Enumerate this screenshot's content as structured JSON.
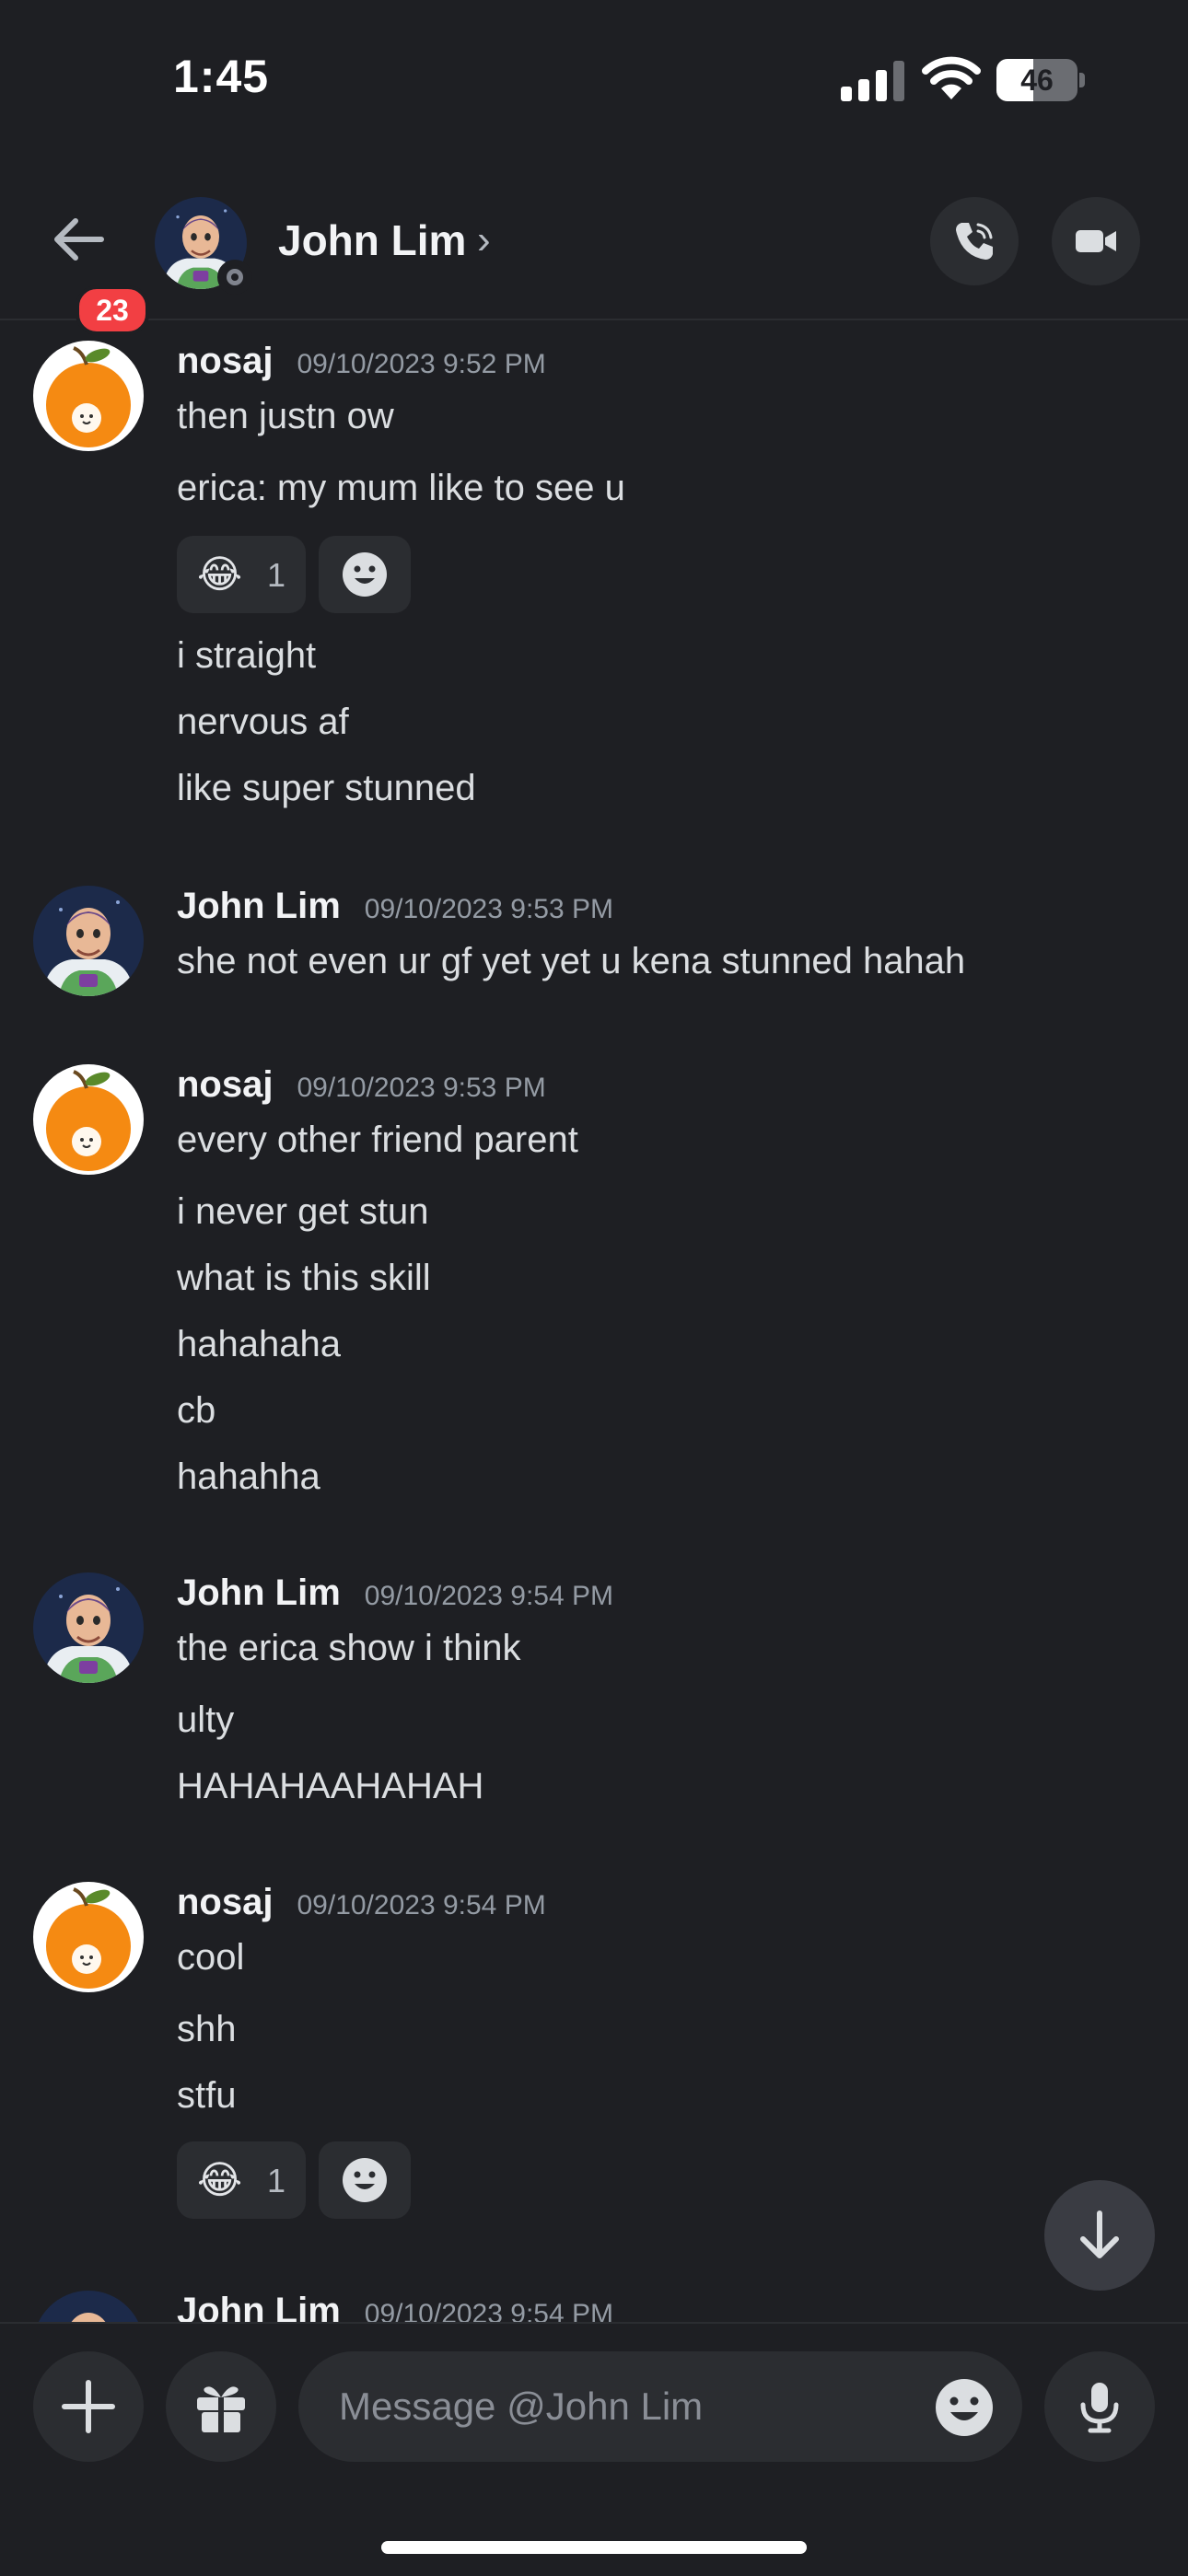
{
  "status_bar": {
    "time": "1:45",
    "battery": "46",
    "battery_level": 0.46
  },
  "header": {
    "unread_badge": "23",
    "name": "John Lim",
    "chevron": "›"
  },
  "messages": [
    {
      "author": "nosaj",
      "timestamp": "09/10/2023 9:52 PM",
      "avatar": "orange-avatar",
      "lines": [
        "then justn ow",
        "erica: my mum like to see u"
      ],
      "reaction": {
        "emoji": "😂",
        "count": "1"
      },
      "lines_after": [
        "i straight",
        "nervous af",
        "like super stunned"
      ]
    },
    {
      "author": "John Lim",
      "timestamp": "09/10/2023 9:53 PM",
      "avatar": "buzz-avatar",
      "lines": [
        "she not even ur gf yet yet u kena stunned hahah"
      ]
    },
    {
      "author": "nosaj",
      "timestamp": "09/10/2023 9:53 PM",
      "avatar": "orange-avatar",
      "lines": [
        "every other friend parent",
        "i never get stun",
        "what is this skill",
        "hahahaha",
        "cb",
        "hahahha"
      ]
    },
    {
      "author": "John Lim",
      "timestamp": "09/10/2023 9:54 PM",
      "avatar": "buzz-avatar",
      "lines": [
        "the erica show i think",
        "ulty",
        "HAHAHAAHAHAH"
      ]
    },
    {
      "author": "nosaj",
      "timestamp": "09/10/2023 9:54 PM",
      "avatar": "orange-avatar",
      "lines": [
        "cool",
        "shh",
        "stfu"
      ],
      "reaction": {
        "emoji": "😂",
        "count": "1"
      }
    },
    {
      "author": "John Lim",
      "timestamp": "09/10/2023 9:54 PM",
      "avatar": "buzz-avatar",
      "lines": []
    }
  ],
  "composer": {
    "placeholder": "Message @John Lim"
  },
  "colors": {
    "background": "#1e1f23",
    "surface": "#2b2d31",
    "badge": "#f23f43",
    "orange": "#f58a12"
  }
}
